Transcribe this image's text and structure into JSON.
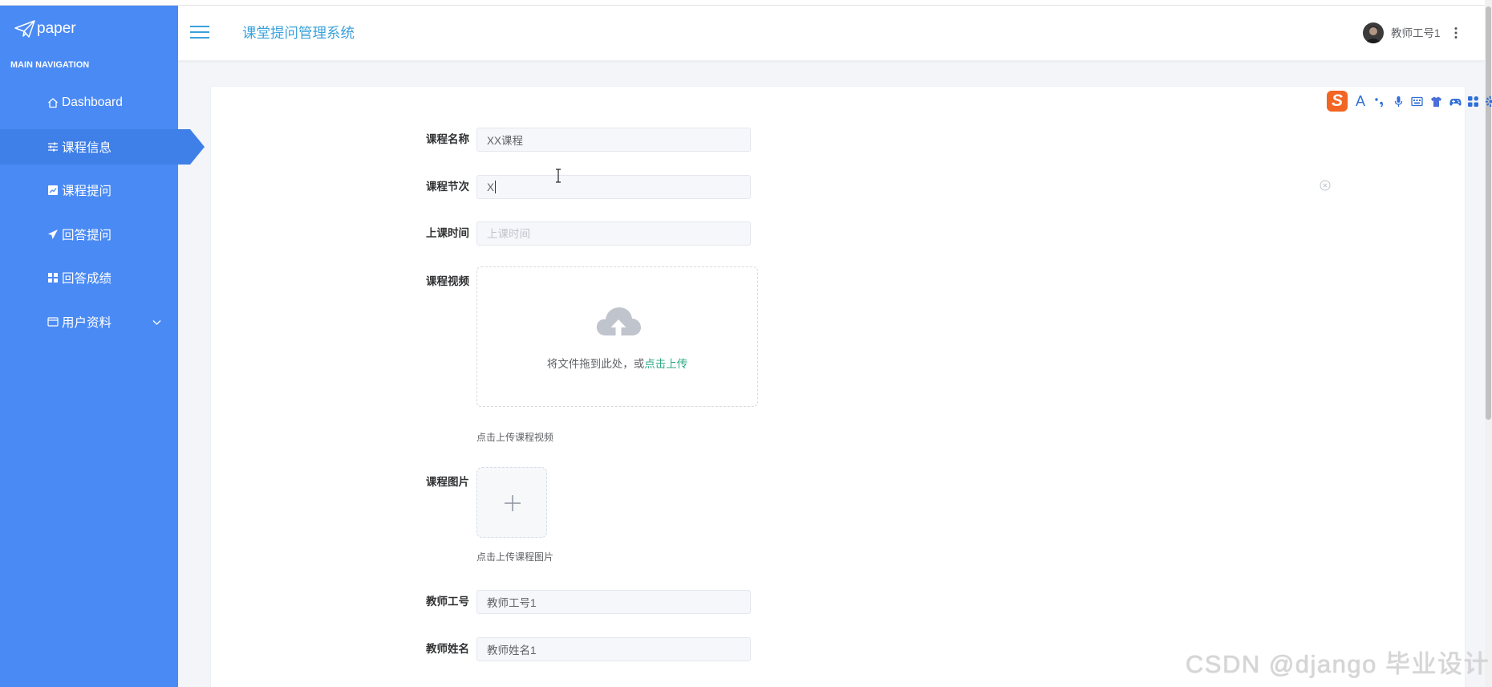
{
  "colors": {
    "sidebar_bg": "#4a8af4",
    "sidebar_active_bg": "#3f7fe8",
    "header_title": "#3ba1da",
    "upload_link": "#2eaa88",
    "ime_logo": "#f26522",
    "ime_icon": "#2f6fd6"
  },
  "sidebar": {
    "logo_icon": "paper-plane-icon",
    "logo_text": "paper",
    "section_title": "MAIN NAVIGATION",
    "items": [
      {
        "label": "Dashboard",
        "icon": "home-icon",
        "active": false
      },
      {
        "label": "课程信息",
        "icon": "sliders-icon",
        "active": true
      },
      {
        "label": "课程提问",
        "icon": "area-chart-icon",
        "active": false
      },
      {
        "label": "回答提问",
        "icon": "send-icon",
        "active": false
      },
      {
        "label": "回答成绩",
        "icon": "grid-icon",
        "active": false
      },
      {
        "label": "用户资料",
        "icon": "id-card-icon",
        "active": false,
        "expand_icon": "chevron-down-icon"
      }
    ]
  },
  "header": {
    "menu_icon": "hamburger-icon",
    "title": "课堂提问管理系统",
    "user": {
      "name": "教师工号1",
      "more_icon": "more-vertical-icon"
    }
  },
  "ime_toolbar": {
    "logo_letter": "S",
    "mode_letter": "A",
    "icons": [
      "punctuation-icon",
      "microphone-icon",
      "keyboard-icon",
      "skin-icon",
      "gamepad-icon",
      "apps-icon",
      "settings-icon"
    ]
  },
  "form": {
    "course_name": {
      "label": "课程名称",
      "value": "XX课程"
    },
    "course_section": {
      "label": "课程节次",
      "value": "X",
      "clear_icon": "circle-close-icon"
    },
    "class_time": {
      "label": "上课时间",
      "placeholder": "上课时间"
    },
    "course_video": {
      "label": "课程视频",
      "upload_icon": "cloud-upload-icon",
      "drop_text": "将文件拖到此处，或",
      "click_text": "点击上传",
      "hint": "点击上传课程视频"
    },
    "course_image": {
      "label": "课程图片",
      "add_icon": "plus-icon",
      "hint": "点击上传课程图片"
    },
    "teacher_id": {
      "label": "教师工号",
      "value": "教师工号1"
    },
    "teacher_name": {
      "label": "教师姓名",
      "value": "教师姓名1"
    }
  },
  "watermark": "CSDN @django 毕业设计"
}
